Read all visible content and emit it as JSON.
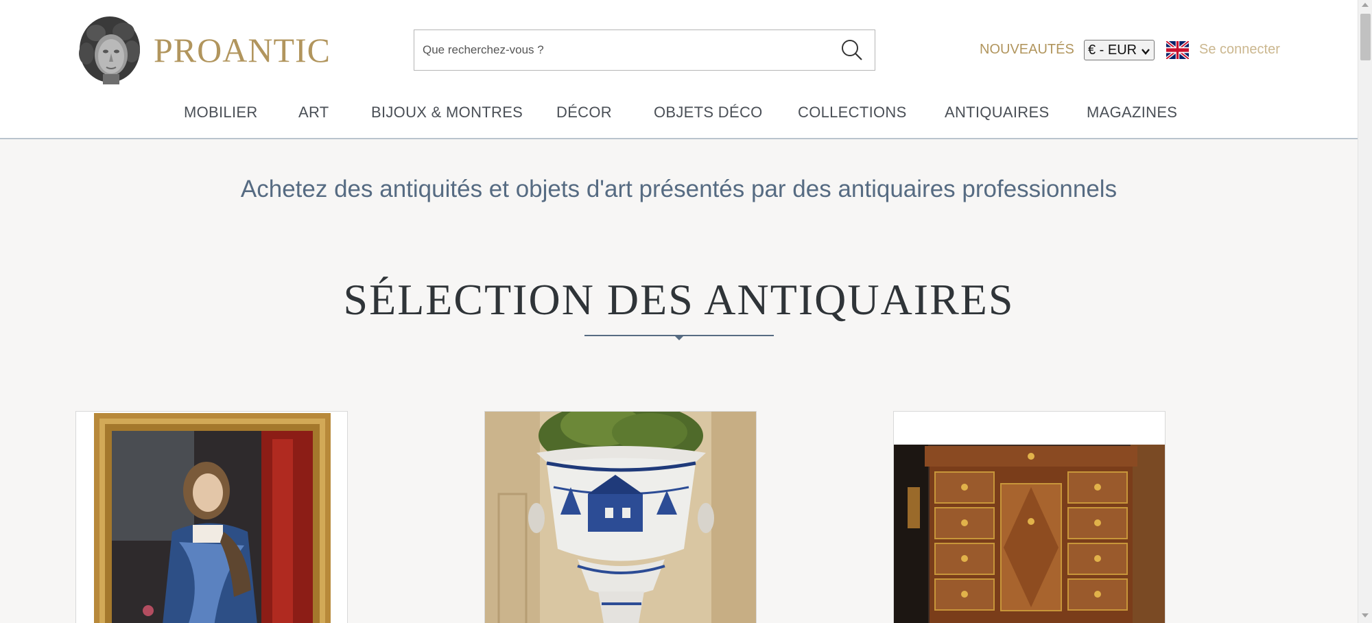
{
  "brand": {
    "name": "PROANTIC",
    "color": "#b1955d"
  },
  "search": {
    "placeholder": "Que recherchez-vous ?",
    "icon": "search-icon"
  },
  "header": {
    "new_label": "NOUVEAUTÉS",
    "currency": "€ - EUR",
    "language_icon": "uk-flag-icon",
    "login_label": "Se connecter"
  },
  "nav": {
    "items": [
      {
        "label": "MOBILIER"
      },
      {
        "label": "ART"
      },
      {
        "label": "BIJOUX & MONTRES"
      },
      {
        "label": "DÉCOR"
      },
      {
        "label": "OBJETS DÉCO"
      },
      {
        "label": "COLLECTIONS"
      },
      {
        "label": "ANTIQUAIRES"
      },
      {
        "label": "MAGAZINES"
      }
    ]
  },
  "tagline": "Achetez des antiquités et objets d'art présentés par des antiquaires professionnels",
  "section": {
    "title": "SÉLECTION DES ANTIQUAIRES"
  },
  "cards": [
    {
      "image": "portrait-painting-image"
    },
    {
      "image": "faience-vase-image"
    },
    {
      "image": "marquetry-desk-image"
    }
  ]
}
